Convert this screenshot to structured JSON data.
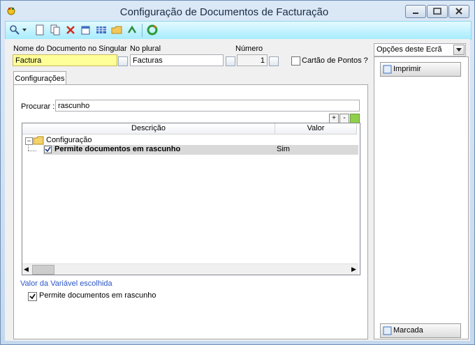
{
  "window": {
    "title": "Configuração de Documentos de Facturação"
  },
  "toolbar": {
    "icons": [
      "search-icon",
      "dropdown-caret-icon",
      "new-document-icon",
      "copy-document-icon",
      "delete-icon",
      "properties-icon",
      "grid-icon",
      "folder-icon",
      "refresh-icon",
      "recycle-icon"
    ]
  },
  "form": {
    "singular_label": "Nome do Documento no Singular",
    "singular_value": "Factura",
    "plural_label": "No plural",
    "plural_value": "Facturas",
    "number_label": "Número",
    "number_value": "1",
    "points_card_label": "Cartão de Pontos ?"
  },
  "tabs": {
    "config_tab": "Configurações"
  },
  "search": {
    "label": "Procurar :",
    "value": "rascunho"
  },
  "grid": {
    "col_description": "Descrição",
    "col_value": "Valor",
    "folder_label": "Configuração",
    "row_label": "Permite documentos em rascunho",
    "row_value": "Sim"
  },
  "detail": {
    "section_title": "Valor da Variável escolhida",
    "checkbox_label": "Permite documentos em rascunho"
  },
  "side": {
    "options_label": "Opções deste Ecrã",
    "print_button": "Imprimir",
    "marked_button": "Marcada"
  },
  "colors": {
    "required_field_bg": "#ffff99",
    "section_title_color": "#2a56c6"
  }
}
